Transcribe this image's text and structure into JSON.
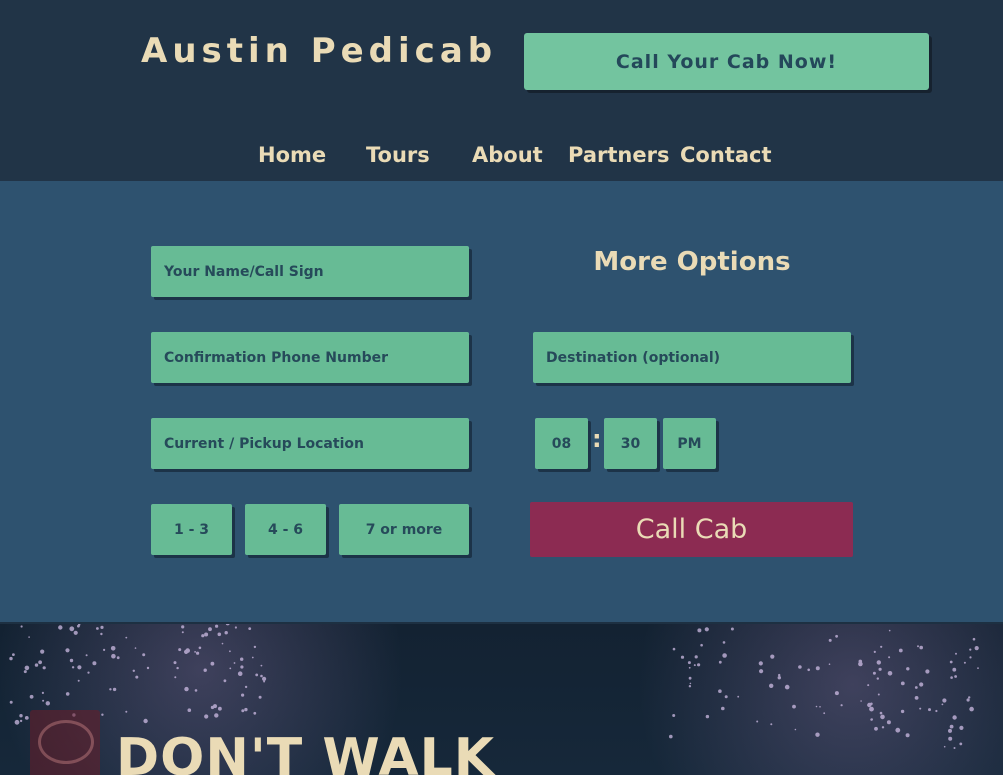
{
  "brand": {
    "name": "Austin Pedicab"
  },
  "header": {
    "cta_label": "Call Your Cab Now!"
  },
  "nav": {
    "items": [
      "Home",
      "Tours",
      "About",
      "Partners",
      "Contact"
    ]
  },
  "form": {
    "name_placeholder": "Your Name/Call Sign",
    "phone_placeholder": "Confirmation Phone Number",
    "pickup_placeholder": "Current / Pickup Location",
    "destination_placeholder": "Destination (optional)",
    "more_options_title": "More Options",
    "time": {
      "hour": "08",
      "separator": ":",
      "minute": "30",
      "period": "PM"
    },
    "party_sizes": [
      "1 - 3",
      "4 - 6",
      "7 or more"
    ],
    "submit_label": "Call Cab"
  },
  "hero": {
    "title": "DON'T WALK"
  },
  "colors": {
    "header_bg": "#213447",
    "panel_bg": "#2e526f",
    "field_bg": "#67bb95",
    "cta_bg": "#73c49f",
    "submit_bg": "#8c2b52",
    "cream_text": "#eadbb6"
  }
}
